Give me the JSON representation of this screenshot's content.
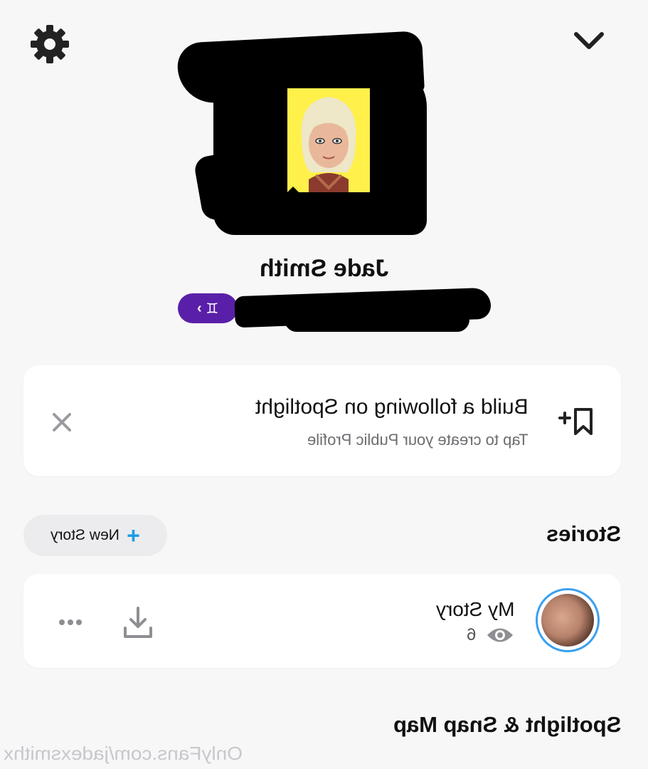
{
  "header": {
    "settings_icon": "gear-icon",
    "collapse_icon": "chevron-down-icon"
  },
  "profile": {
    "display_name": "Jade Smith",
    "zodiac_symbol": "♊",
    "zodiac_chevron": "›",
    "bitmoji_background": "#fff04a"
  },
  "spotlight_card": {
    "title": "Build a following on Spotlight",
    "subtitle": "Tap to create your Public Profile",
    "icon": "bookmark-plus-icon",
    "dismiss_icon": "close-icon"
  },
  "stories": {
    "title": "Stories",
    "new_story_label": "New Story",
    "new_story_icon": "plus-icon",
    "my_story": {
      "name": "My Story",
      "views": "6",
      "accent": "#3aa0f0"
    }
  },
  "spotlight_map": {
    "title": "Spotlight & Snap Map"
  },
  "watermark": "OnlyFans.com/jadexsmithx"
}
